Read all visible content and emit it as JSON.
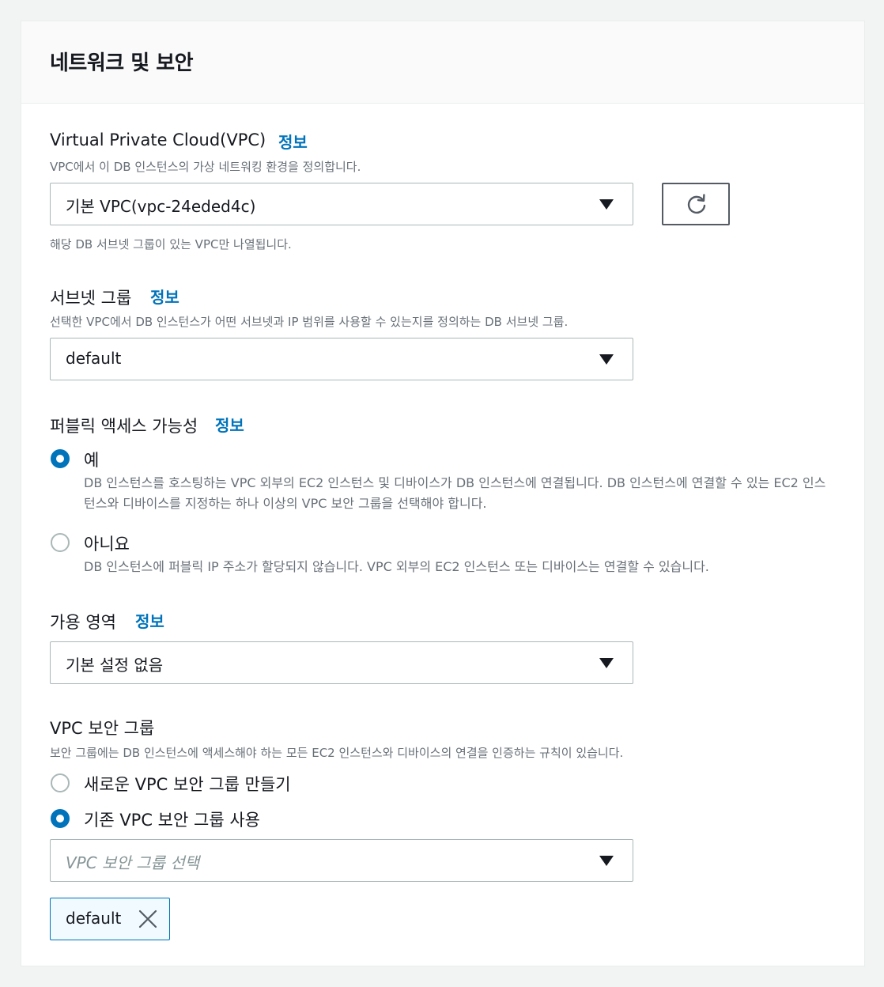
{
  "section": {
    "title": "네트워크 및 보안"
  },
  "vpc": {
    "label": "Virtual Private Cloud(VPC)",
    "info": "정보",
    "description": "VPC에서 이 DB 인스턴스의 가상 네트워킹 환경을 정의합니다.",
    "selected": "기본 VPC(vpc-24eded4c)",
    "hint": "해당 DB 서브넷 그룹이 있는 VPC만 나열됩니다."
  },
  "subnet": {
    "label": "서브넷 그룹",
    "info": "정보",
    "description": "선택한 VPC에서 DB 인스턴스가 어떤 서브넷과 IP 범위를 사용할 수 있는지를 정의하는 DB 서브넷 그룹.",
    "selected": "default"
  },
  "public_access": {
    "label": "퍼블릭 액세스 가능성",
    "info": "정보",
    "options": [
      {
        "label": "예",
        "selected": true,
        "description": "DB 인스턴스를 호스팅하는 VPC 외부의 EC2 인스턴스 및 디바이스가 DB 인스턴스에 연결됩니다. DB 인스턴스에 연결할 수 있는 EC2 인스턴스와 디바이스를 지정하는 하나 이상의 VPC 보안 그룹을 선택해야 합니다."
      },
      {
        "label": "아니요",
        "selected": false,
        "description": "DB 인스턴스에 퍼블릭 IP 주소가 할당되지 않습니다. VPC 외부의 EC2 인스턴스 또는 디바이스는 연결할 수 있습니다."
      }
    ]
  },
  "availability_zone": {
    "label": "가용 영역",
    "info": "정보",
    "selected": "기본 설정 없음"
  },
  "security_group": {
    "label": "VPC 보안 그룹",
    "description": "보안 그룹에는 DB 인스턴스에 액세스해야 하는 모든 EC2 인스턴스와 디바이스의 연결을 인증하는 규칙이 있습니다.",
    "options": [
      {
        "label": "새로운 VPC 보안 그룹 만들기",
        "selected": false
      },
      {
        "label": "기존 VPC 보안 그룹 사용",
        "selected": true
      }
    ],
    "select_placeholder": "VPC 보안 그룹 선택",
    "tokens": [
      {
        "label": "default"
      }
    ]
  },
  "colors": {
    "link": "#0073bb",
    "text": "#16191f",
    "muted": "#687078",
    "border": "#aab7b8",
    "page_bg": "#f2f3f3",
    "token_bg": "#f1faff"
  },
  "icons": {
    "refresh": "refresh-icon",
    "caret": "caret-down-icon",
    "remove": "close-icon"
  }
}
